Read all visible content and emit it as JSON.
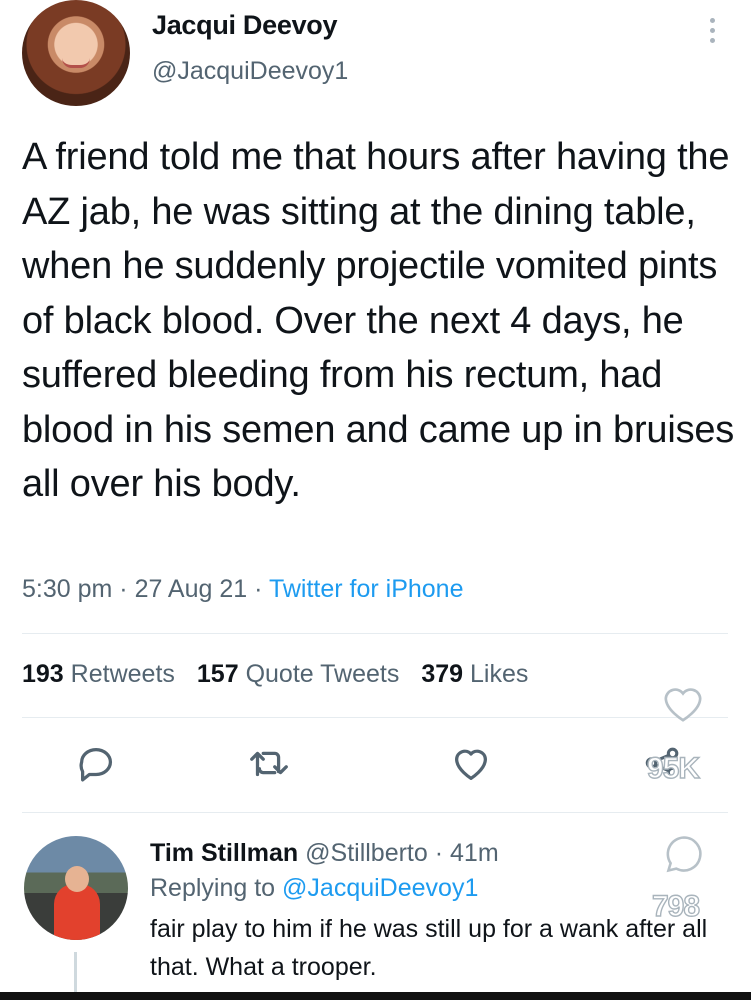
{
  "tweet": {
    "author_name": "Jacqui Deevoy",
    "author_handle": "@JacquiDeevoy1",
    "text": "A friend told me that hours after having the AZ jab, he was sitting at the dining table, when he suddenly projectile vomited pints of black blood. Over the next 4 days, he suffered bleeding from his rectum, had blood in his semen and came up in bruises all over his body.",
    "time": "5:30 pm",
    "date": "27 Aug 21",
    "source": "Twitter for iPhone",
    "sep": " · "
  },
  "stats": {
    "retweets_count": "193",
    "retweets_label": "Retweets",
    "quotes_count": "157",
    "quotes_label": "Quote Tweets",
    "likes_count": "379",
    "likes_label": "Likes"
  },
  "overlay": {
    "likes_count": "95K",
    "comments_count": "798"
  },
  "reply": {
    "author_name": "Tim Stillman",
    "author_handle": "@Stillberto",
    "time": "41m",
    "replying_prefix": "Replying to ",
    "replying_to": "@JacquiDeevoy1",
    "text": "fair play to him if he was still up for a wank after all that. What a trooper."
  },
  "colors": {
    "accent": "#1d9bf0",
    "secondary_text": "#536471",
    "primary_text": "#0f1419"
  }
}
